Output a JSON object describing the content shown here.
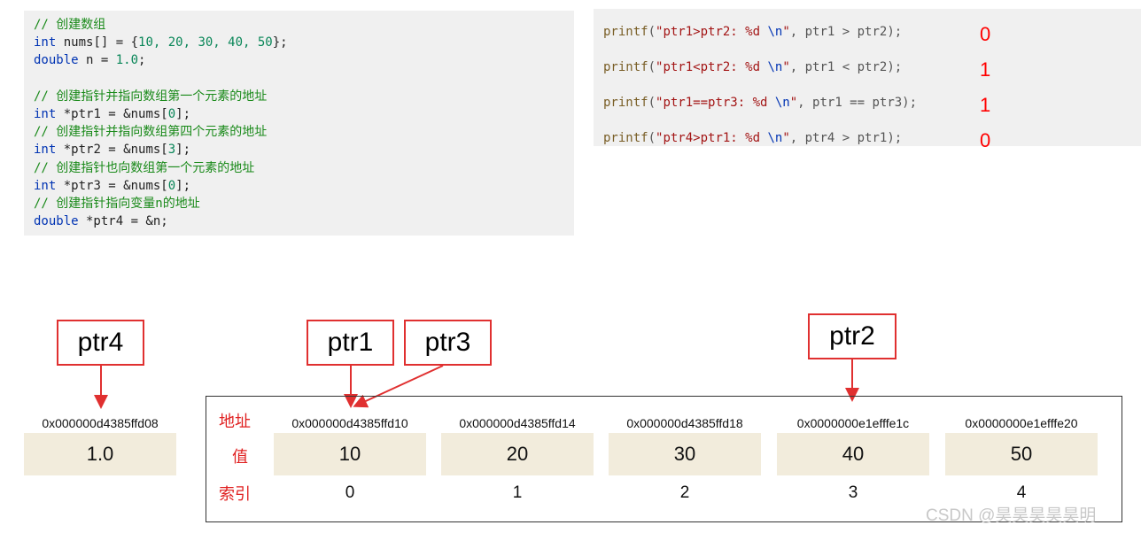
{
  "code_left": {
    "lines": [
      {
        "type": "comment",
        "text": "// 创建数组"
      },
      {
        "type": "code",
        "kw": "int",
        "rest": " nums[] = {",
        "nums": "10, 20, 30, 40, 50",
        "tail": "};"
      },
      {
        "type": "code",
        "kw": "double",
        "rest": " n = ",
        "nums": "1.0",
        "tail": ";"
      },
      {
        "type": "blank"
      },
      {
        "type": "comment",
        "text": "// 创建指针并指向数组第一个元素的地址"
      },
      {
        "type": "code",
        "kw": "int",
        "rest": " *ptr1 = &nums[",
        "nums": "0",
        "tail": "];"
      },
      {
        "type": "comment",
        "text": "// 创建指针并指向数组第四个元素的地址"
      },
      {
        "type": "code",
        "kw": "int",
        "rest": " *ptr2 = &nums[",
        "nums": "3",
        "tail": "];"
      },
      {
        "type": "comment",
        "text": "// 创建指针也向数组第一个元素的地址"
      },
      {
        "type": "code",
        "kw": "int",
        "rest": " *ptr3 = &nums[",
        "nums": "0",
        "tail": "];"
      },
      {
        "type": "comment",
        "text": "// 创建指针指向变量n的地址"
      },
      {
        "type": "code",
        "kw": "double",
        "rest": " *ptr4 = &n;",
        "nums": "",
        "tail": ""
      }
    ]
  },
  "code_right": {
    "lines": [
      {
        "fn": "printf",
        "open": "(",
        "str": "\"ptr1>ptr2: %d ",
        "esc": "\\n",
        "str2": "\"",
        "rest": ", ptr1 > ptr2);",
        "result": "0"
      },
      {
        "fn": "printf",
        "open": "(",
        "str": "\"ptr1<ptr2: %d ",
        "esc": "\\n",
        "str2": "\"",
        "rest": ", ptr1 < ptr2);",
        "result": "1"
      },
      {
        "fn": "printf",
        "open": "(",
        "str": "\"ptr1==ptr3: %d ",
        "esc": "\\n",
        "str2": "\"",
        "rest": ", ptr1 == ptr3);",
        "result": "1"
      },
      {
        "fn": "printf",
        "open": "(",
        "str": "\"ptr4>ptr1: %d ",
        "esc": "\\n",
        "str2": "\"",
        "rest": ", ptr4 > ptr1);",
        "result": "0"
      }
    ]
  },
  "pointers": {
    "ptr4": "ptr4",
    "ptr1": "ptr1",
    "ptr3": "ptr3",
    "ptr2": "ptr2"
  },
  "variable_n": {
    "address": "0x000000d4385ffd08",
    "value": "1.0"
  },
  "row_labels": {
    "address": "地址",
    "value": "值",
    "index": "索引"
  },
  "array": [
    {
      "address": "0x000000d4385ffd10",
      "value": "10",
      "index": "0"
    },
    {
      "address": "0x000000d4385ffd14",
      "value": "20",
      "index": "1"
    },
    {
      "address": "0x000000d4385ffd18",
      "value": "30",
      "index": "2"
    },
    {
      "address": "0x0000000e1efffe1c",
      "value": "40",
      "index": "3"
    },
    {
      "address": "0x0000000e1efffe20",
      "value": "50",
      "index": "4"
    }
  ],
  "watermark": "CSDN @昊昊昊昊昊明",
  "colors": {
    "accent_red": "#e03030",
    "cell_bg": "#f2ecdc",
    "code_bg": "#f0f0f0",
    "comment": "#1a8a1a"
  }
}
